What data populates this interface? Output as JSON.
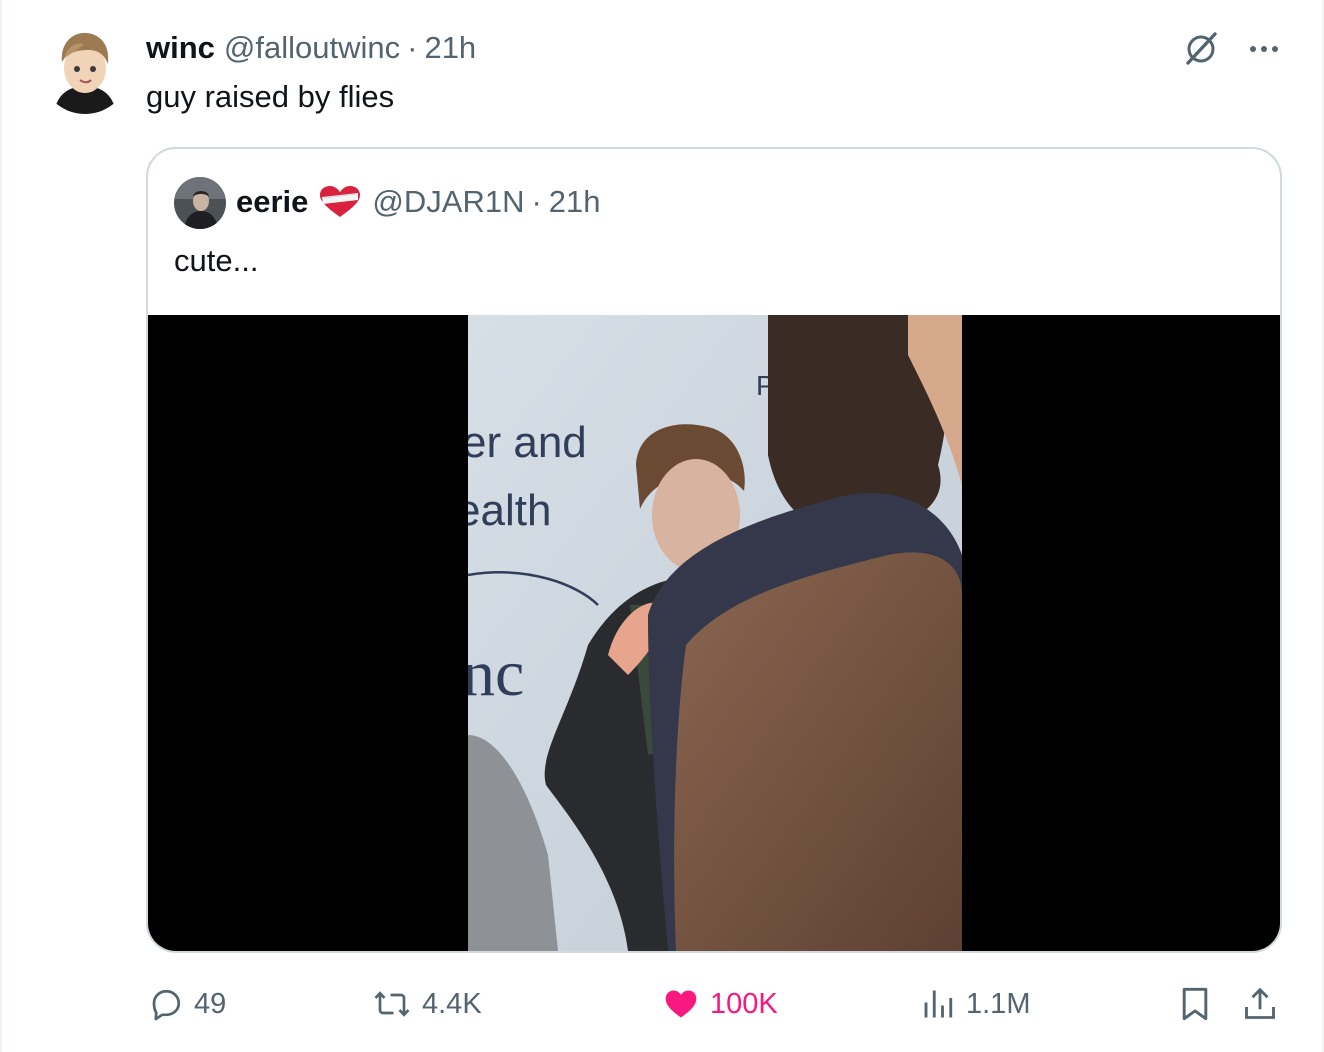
{
  "colors": {
    "text_primary": "#0f1419",
    "text_secondary": "#536471",
    "border": "#cfd9de",
    "like": "#f91880"
  },
  "post": {
    "author_name": "winc",
    "author_handle": "@falloutwinc",
    "separator": "·",
    "time": "21h",
    "text": "guy raised by flies",
    "avatar_icon": "cartoon-avatar"
  },
  "quoted_post": {
    "author_name": "eerie",
    "badge_icon": "bandaged-heart-icon",
    "author_handle": "@DJAR1N",
    "separator": "·",
    "time": "21h",
    "text": "cute...",
    "media": {
      "type": "video",
      "visible_sign_text": [
        "er and",
        "ealth",
        "nc",
        "P"
      ]
    }
  },
  "header_actions": {
    "grok_icon": "grok-icon",
    "more_icon": "more-icon"
  },
  "actions": {
    "replies": {
      "icon": "reply-icon",
      "count": "49"
    },
    "reposts": {
      "icon": "repost-icon",
      "count": "4.4K"
    },
    "likes": {
      "icon": "heart-icon",
      "count": "100K",
      "liked": true
    },
    "views": {
      "icon": "views-icon",
      "count": "1.1M"
    },
    "bookmark": {
      "icon": "bookmark-icon"
    },
    "share": {
      "icon": "share-icon"
    }
  }
}
